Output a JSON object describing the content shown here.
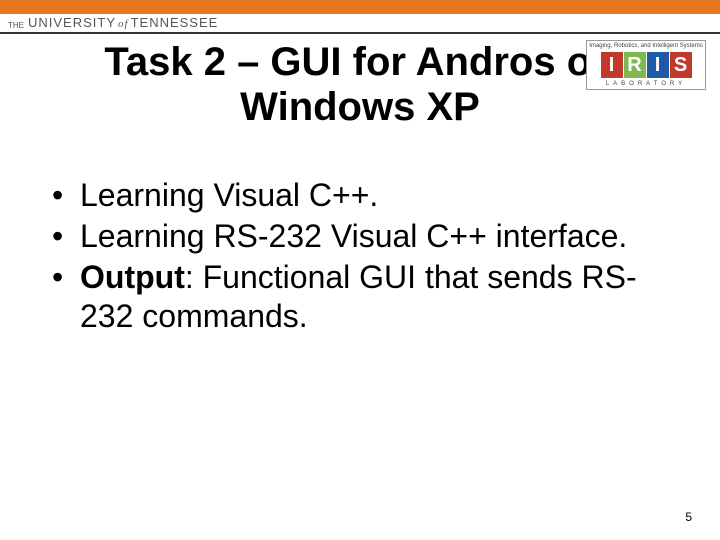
{
  "header": {
    "orange_bar": true,
    "uni_the": "THE",
    "uni_university": "UNIVERSITY",
    "uni_of": "of",
    "uni_tennessee": "TENNESSEE"
  },
  "logo": {
    "top_text": "Imaging, Robotics, and Intelligent Systems",
    "letters": [
      "I",
      "R",
      "I",
      "S"
    ],
    "bottom_text": "LABORATORY"
  },
  "title": "Task 2 – GUI for Andros on Windows XP",
  "bullets": [
    {
      "text": "Learning Visual C++."
    },
    {
      "text": "Learning RS-232 Visual C++ interface."
    },
    {
      "prefix_bold": "Output",
      "text": ": Functional GUI that sends RS-232 commands."
    }
  ],
  "page_number": "5"
}
